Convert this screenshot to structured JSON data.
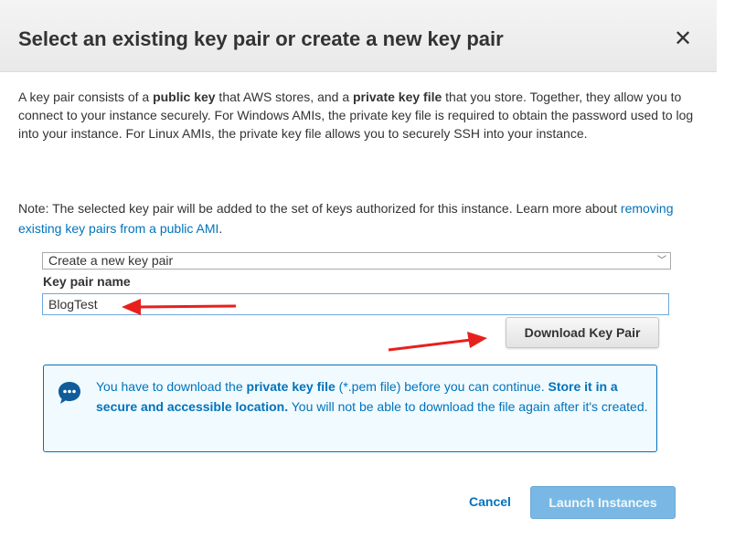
{
  "modal": {
    "title": "Select an existing key pair or create a new key pair",
    "close_glyph": "✕"
  },
  "description": {
    "t1": "A key pair consists of a ",
    "b1": "public key",
    "t2": " that AWS stores, and a ",
    "b2": "private key file",
    "t3": " that you store. Together, they allow you to connect to your instance securely. For Windows AMIs, the private key file is required to obtain the password used to log into your instance. For Linux AMIs, the private key file allows you to securely SSH into your instance."
  },
  "note": {
    "text": "Note: The selected key pair will be added to the set of keys authorized for this instance. Learn more about ",
    "link": "removing existing key pairs from a public AMI",
    "end": "."
  },
  "keypair_select": {
    "selected": "Create a new key pair",
    "chevron": "﹀"
  },
  "keypair_name": {
    "label": "Key pair name",
    "value": "BlogTest"
  },
  "download_button": "Download Key Pair",
  "info": {
    "t1": "You have to download the ",
    "b1": "private key file",
    "t2": " (*.pem file) before you can continue. ",
    "b2": "Store it in a secure and accessible location.",
    "t3": " You will not be able to download the file again after it's created."
  },
  "footer": {
    "cancel": "Cancel",
    "launch": "Launch Instances"
  },
  "colors": {
    "link": "#0073bb",
    "info_bg": "#f1faff",
    "arrow": "#e8201c",
    "launch_disabled": "#79b8e4"
  },
  "icons": {
    "info": "chat-bubble-dots-icon",
    "close": "close-icon"
  }
}
